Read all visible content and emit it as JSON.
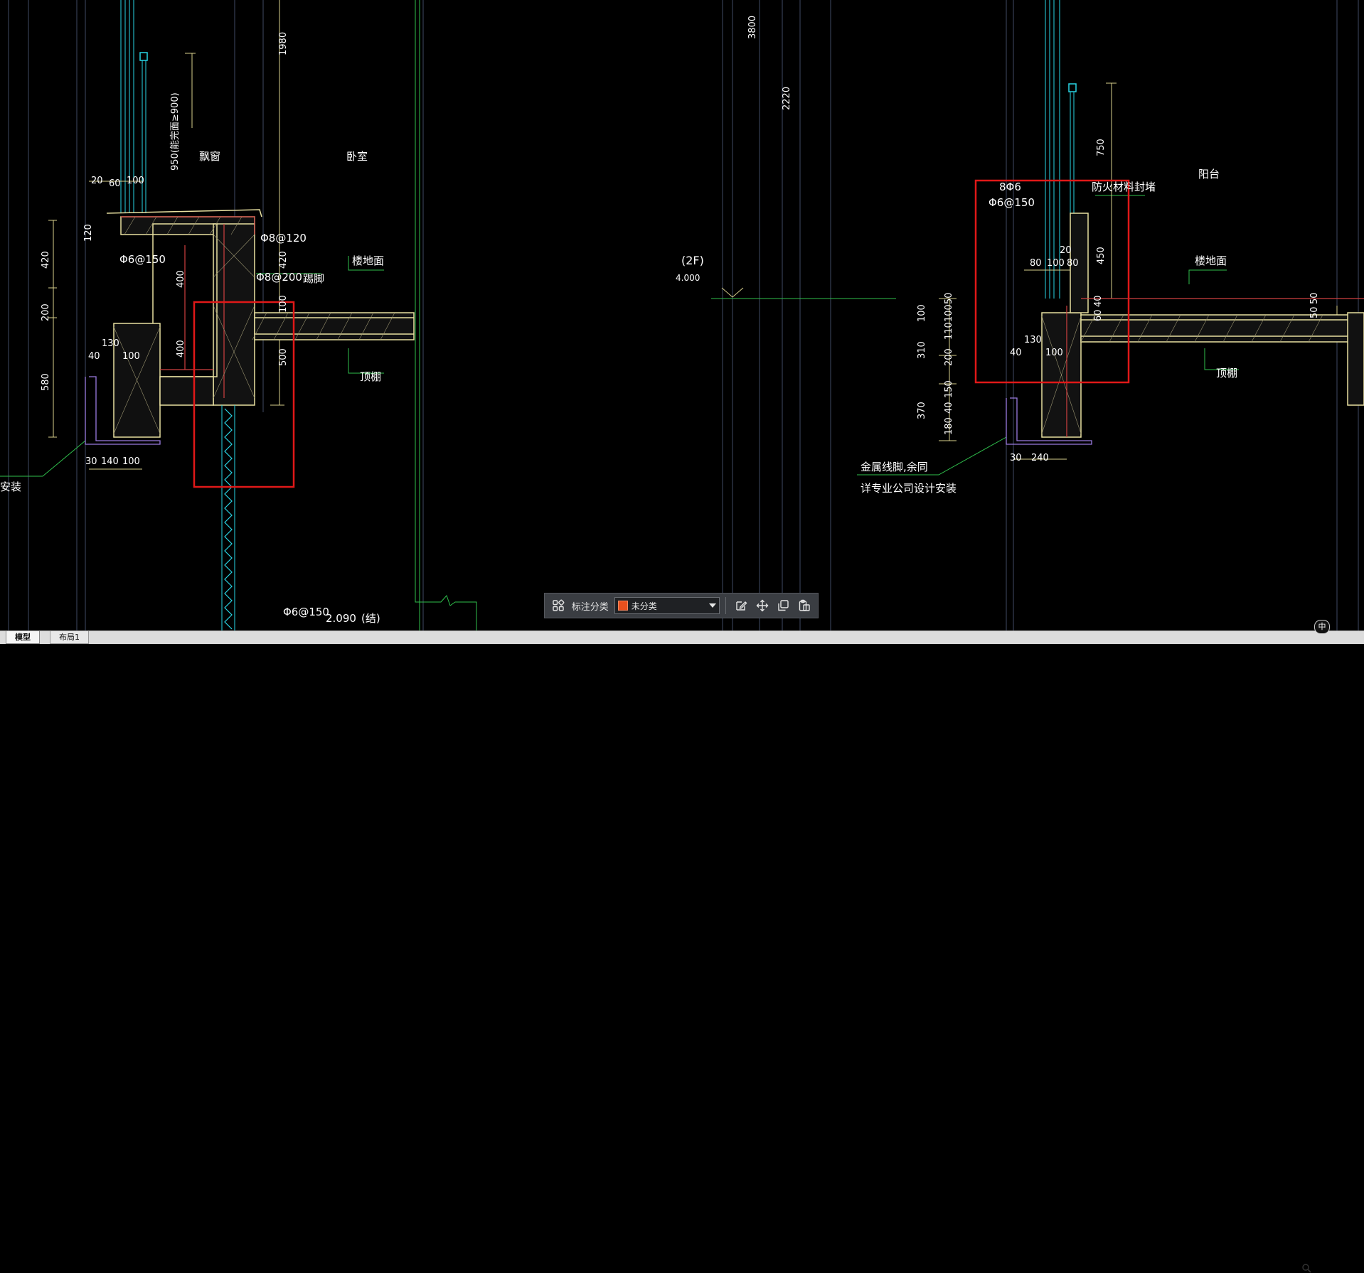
{
  "toolbar": {
    "label": "标注分类",
    "select_value": "未分类",
    "swatch_color": "#e8501e",
    "icons": [
      "grid-apps-icon",
      "edit-note-icon",
      "move-arrows-icon",
      "copy-icon",
      "paste-icon"
    ]
  },
  "tabs": [
    {
      "label": "模型",
      "active": true
    },
    {
      "label": "布局1",
      "active": false
    }
  ],
  "ime_indicator": "中",
  "drawing": {
    "level": {
      "name": "(2F)",
      "value": "4.000"
    },
    "rooms": [
      "飘窗",
      "卧室",
      "阳台"
    ],
    "labels": [
      "楼地面",
      "顶棚",
      "踢脚",
      "防火材料封堵",
      "金属线脚,余同",
      "详专业公司设计安装",
      "安装"
    ],
    "bottom_note": {
      "rebar": "Φ6@150",
      "elev": "2.090",
      "tag": "(结)"
    },
    "rebar": [
      "Φ8@120",
      "Φ8@200",
      "Φ6@150",
      "8Φ6"
    ],
    "vertical_dims": [
      "1980",
      "3800",
      "2220",
      "950(能完面≥900)",
      "750",
      "450"
    ],
    "dims_left_col": [
      "420",
      "200",
      "580"
    ],
    "dims_mid": [
      "120",
      "420",
      "400",
      "400",
      "100",
      "500"
    ],
    "dims_top_left": [
      "20",
      "60",
      "100"
    ],
    "dims_bottom_left": [
      "30",
      "140",
      "100"
    ],
    "dims_section_left": [
      "130",
      "100",
      "40"
    ],
    "dims_right_col": [
      "100",
      "310",
      "370"
    ],
    "dims_right_col2": [
      "50",
      "100",
      "110",
      "200",
      "150",
      "40",
      "180"
    ],
    "dims_right_top": [
      "80",
      "100",
      "80",
      "20"
    ],
    "dims_right_small": [
      "40",
      "60",
      "50",
      "50"
    ],
    "dims_right_section": [
      "130",
      "100",
      "40"
    ],
    "dims_right_bottom": [
      "30",
      "240"
    ]
  },
  "colors": {
    "background": "#000000",
    "highlight_box": "#e01818",
    "wall_line": "#e8e0a0",
    "cyan": "#29d6e6",
    "green": "#2fbf4c",
    "text_white": "#ffffff"
  }
}
